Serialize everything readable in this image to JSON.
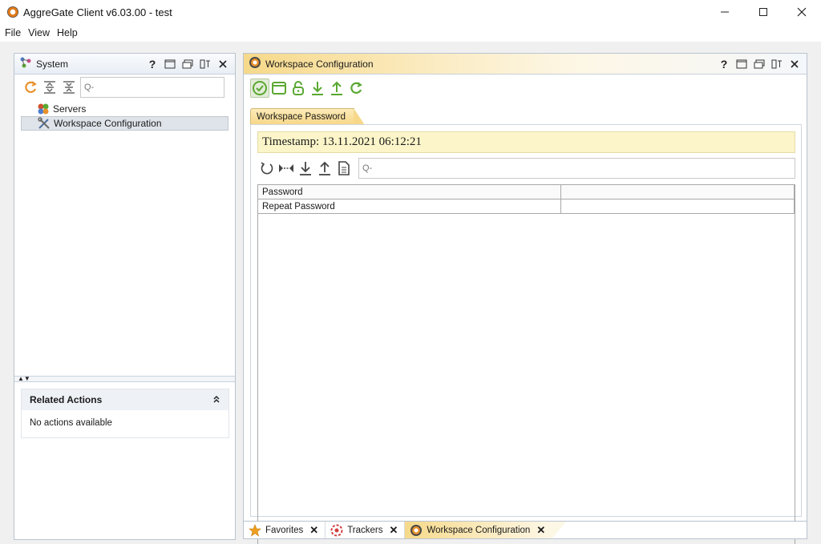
{
  "window": {
    "title": "AggreGate Client v6.03.00 - test"
  },
  "menu": {
    "items": [
      "File",
      "View",
      "Help"
    ]
  },
  "system_panel": {
    "title": "System",
    "help_label": "?",
    "search_placeholder": "Q-",
    "tree": [
      {
        "label": "Servers",
        "icon": "servers-icon",
        "selected": false
      },
      {
        "label": "Workspace Configuration",
        "icon": "wrench-screwdriver-icon",
        "selected": true
      }
    ],
    "related_actions": {
      "title": "Related Actions",
      "empty_text": "No actions available"
    }
  },
  "workspace_panel": {
    "title": "Workspace Configuration",
    "help_label": "?",
    "tab_label": "Workspace Password",
    "timestamp": "Timestamp: 13.11.2021 06:12:21",
    "search_placeholder": "Q-",
    "properties": [
      {
        "name": "Password",
        "value": ""
      },
      {
        "name": "Repeat Password",
        "value": ""
      }
    ]
  },
  "bottom_tabs": [
    {
      "label": "Favorites",
      "icon": "star-icon",
      "active": false
    },
    {
      "label": "Trackers",
      "icon": "trackers-icon",
      "active": false
    },
    {
      "label": "Workspace Configuration",
      "icon": "aggregate-icon",
      "active": true
    }
  ],
  "colors": {
    "accent_green": "#5aa832",
    "accent_orange": "#e8912a",
    "active_tab": "#f7d88a",
    "timestamp_bg": "#fbf5c9"
  }
}
